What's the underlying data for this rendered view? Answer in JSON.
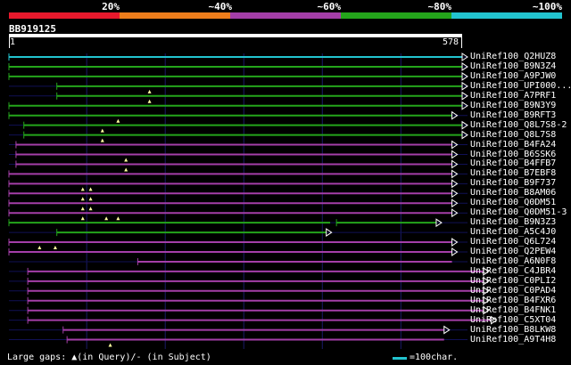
{
  "legend": {
    "labels": [
      "20%",
      "~40%",
      "~60%",
      "~80%",
      "~100%"
    ],
    "colors": [
      "#e8192c",
      "#ee7d1b",
      "#a43ea8",
      "#24a51b",
      "#22c4cf"
    ]
  },
  "query": {
    "name": "BB919125",
    "start": "1",
    "end": "578",
    "length": 578
  },
  "hits": [
    {
      "name": "UniRef100_Q2HUZ8",
      "color": "#22c4cf",
      "segs": [
        [
          1,
          578
        ]
      ],
      "gaps": [],
      "arrow": true
    },
    {
      "name": "UniRef100_B9N3Z4",
      "color": "#24a51b",
      "segs": [
        [
          1,
          578
        ]
      ],
      "gaps": [],
      "arrow": true
    },
    {
      "name": "UniRef100_A9PJW0",
      "color": "#24a51b",
      "segs": [
        [
          1,
          578
        ]
      ],
      "gaps": [],
      "arrow": true
    },
    {
      "name": "UniRef100_UPI000...",
      "color": "#24a51b",
      "segs": [
        [
          62,
          578
        ]
      ],
      "gaps": [
        180
      ],
      "arrow": true
    },
    {
      "name": "UniRef100_A7PRF1",
      "color": "#24a51b",
      "segs": [
        [
          62,
          578
        ]
      ],
      "gaps": [
        180
      ],
      "arrow": true
    },
    {
      "name": "UniRef100_B9N3Y9",
      "color": "#24a51b",
      "segs": [
        [
          1,
          578
        ]
      ],
      "gaps": [],
      "arrow": true
    },
    {
      "name": "UniRef100_B9RFT3",
      "color": "#24a51b",
      "segs": [
        [
          1,
          565
        ]
      ],
      "gaps": [
        140
      ],
      "arrow": true
    },
    {
      "name": "UniRef100_Q8L7S8-2",
      "color": "#24a51b",
      "segs": [
        [
          20,
          578
        ]
      ],
      "gaps": [
        120
      ],
      "arrow": true
    },
    {
      "name": "UniRef100_Q8L7S8",
      "color": "#24a51b",
      "segs": [
        [
          20,
          578
        ]
      ],
      "gaps": [
        120
      ],
      "arrow": true
    },
    {
      "name": "UniRef100_B4FA24",
      "color": "#a43ea8",
      "segs": [
        [
          10,
          565
        ]
      ],
      "gaps": [],
      "arrow": true
    },
    {
      "name": "UniRef100_B6SSK6",
      "color": "#a43ea8",
      "segs": [
        [
          10,
          565
        ]
      ],
      "gaps": [
        150
      ],
      "arrow": true
    },
    {
      "name": "UniRef100_B4FFB7",
      "color": "#a43ea8",
      "segs": [
        [
          10,
          565
        ]
      ],
      "gaps": [
        150
      ],
      "arrow": true
    },
    {
      "name": "UniRef100_B7EBF8",
      "color": "#a43ea8",
      "segs": [
        [
          1,
          565
        ]
      ],
      "gaps": [],
      "arrow": true
    },
    {
      "name": "UniRef100_B9F737",
      "color": "#a43ea8",
      "segs": [
        [
          1,
          565
        ]
      ],
      "gaps": [
        95,
        105
      ],
      "arrow": true
    },
    {
      "name": "UniRef100_B8AM06",
      "color": "#a43ea8",
      "segs": [
        [
          1,
          565
        ]
      ],
      "gaps": [
        95,
        105
      ],
      "arrow": true
    },
    {
      "name": "UniRef100_Q0DM51",
      "color": "#a43ea8",
      "segs": [
        [
          1,
          565
        ]
      ],
      "gaps": [
        95,
        105
      ],
      "arrow": true
    },
    {
      "name": "UniRef100_Q0DM51-3",
      "color": "#a43ea8",
      "segs": [
        [
          1,
          565
        ]
      ],
      "gaps": [
        95,
        125,
        140
      ],
      "arrow": true
    },
    {
      "name": "UniRef100_B9N3Z3",
      "color": "#24a51b",
      "segs": [
        [
          1,
          410
        ],
        [
          418,
          545
        ]
      ],
      "gaps": [],
      "arrow": true
    },
    {
      "name": "UniRef100_A5C4J0",
      "color": "#24a51b",
      "segs": [
        [
          62,
          405
        ]
      ],
      "gaps": [],
      "arrow": true
    },
    {
      "name": "UniRef100_Q6L724",
      "color": "#a43ea8",
      "segs": [
        [
          1,
          565
        ]
      ],
      "gaps": [
        40,
        60
      ],
      "arrow": true
    },
    {
      "name": "UniRef100_Q2PEW4",
      "color": "#a43ea8",
      "segs": [
        [
          1,
          565
        ]
      ],
      "gaps": [],
      "arrow": true
    },
    {
      "name": "UniRef100_A6N0F8",
      "color": "#a43ea8",
      "segs": [
        [
          165,
          565
        ]
      ],
      "gaps": [],
      "arrow": false
    },
    {
      "name": "UniRef100_C4JBR4",
      "color": "#a43ea8",
      "segs": [
        [
          25,
          605
        ]
      ],
      "gaps": [],
      "arrow": true
    },
    {
      "name": "UniRef100_C0PLI2",
      "color": "#a43ea8",
      "segs": [
        [
          25,
          605
        ]
      ],
      "gaps": [],
      "arrow": true
    },
    {
      "name": "UniRef100_C0PAD4",
      "color": "#a43ea8",
      "segs": [
        [
          25,
          605
        ]
      ],
      "gaps": [],
      "arrow": true
    },
    {
      "name": "UniRef100_B4FXR6",
      "color": "#a43ea8",
      "segs": [
        [
          25,
          605
        ]
      ],
      "gaps": [],
      "arrow": true
    },
    {
      "name": "UniRef100_B4FNK1",
      "color": "#a43ea8",
      "segs": [
        [
          25,
          605
        ]
      ],
      "gaps": [],
      "arrow": true
    },
    {
      "name": "UniRef100_C5XT04",
      "color": "#a43ea8",
      "segs": [
        [
          25,
          615
        ]
      ],
      "gaps": [],
      "arrow": true
    },
    {
      "name": "UniRef100_B8LKW8",
      "color": "#a43ea8",
      "segs": [
        [
          70,
          555
        ]
      ],
      "gaps": [],
      "arrow": true
    },
    {
      "name": "UniRef100_A9T4H8",
      "color": "#a43ea8",
      "segs": [
        [
          75,
          555
        ]
      ],
      "gaps": [
        130
      ],
      "arrow": false
    }
  ],
  "footer": {
    "gaps_text": "Large gaps: ▲(in Query)/- (in Subject)",
    "scale_text": "=100char.",
    "scale_color": "#22c4cf"
  }
}
